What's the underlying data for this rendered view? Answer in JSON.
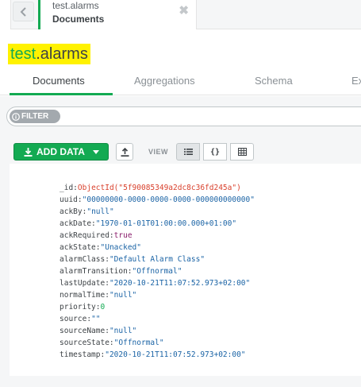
{
  "tab": {
    "namespace": "test.alarms",
    "subtitle": "Documents",
    "close_symbol": "✖"
  },
  "title": {
    "db": "test",
    "dot_coll": ".alarms"
  },
  "collection_tabs": [
    "Documents",
    "Aggregations",
    "Schema",
    "Ex"
  ],
  "filter": {
    "pill_label": "FILTER"
  },
  "toolbar": {
    "add_label": "ADD DATA",
    "view_label": "VIEW",
    "json_view_symbol": "{}"
  },
  "document": {
    "fields": [
      {
        "key": "_id",
        "value": "ObjectId(\"5f90085349a2dc8c36fd245a\")",
        "type": "oid"
      },
      {
        "key": "uuid",
        "value": "\"00000000-0000-0000-0000-000000000000\"",
        "type": "str"
      },
      {
        "key": "ackBy",
        "value": "\"null\"",
        "type": "str"
      },
      {
        "key": "ackDate",
        "value": "\"1970-01-01T01:00:00.000+01:00\"",
        "type": "str"
      },
      {
        "key": "ackRequired",
        "value": "true",
        "type": "bool"
      },
      {
        "key": "ackState",
        "value": "\"Unacked\"",
        "type": "str"
      },
      {
        "key": "alarmClass",
        "value": "\"Default Alarm Class\"",
        "type": "str"
      },
      {
        "key": "alarmTransition",
        "value": "\"Offnormal\"",
        "type": "str"
      },
      {
        "key": "lastUpdate",
        "value": "\"2020-10-21T11:07:52.973+02:00\"",
        "type": "str"
      },
      {
        "key": "normalTime",
        "value": "\"null\"",
        "type": "str"
      },
      {
        "key": "priority",
        "value": "0",
        "type": "num"
      },
      {
        "key": "source",
        "value": "\"\"",
        "type": "str"
      },
      {
        "key": "sourceName",
        "value": "\"null\"",
        "type": "str"
      },
      {
        "key": "sourceState",
        "value": "\"Offnormal\"",
        "type": "str"
      },
      {
        "key": "timestamp",
        "value": "\"2020-10-21T11:07:52.973+02:00\"",
        "type": "str"
      }
    ]
  },
  "colors": {
    "accent": "#13aa52",
    "highlight": "#fff200",
    "string": "#1a63a5",
    "objectid": "#d9412d",
    "bool": "#8a1c6b"
  }
}
